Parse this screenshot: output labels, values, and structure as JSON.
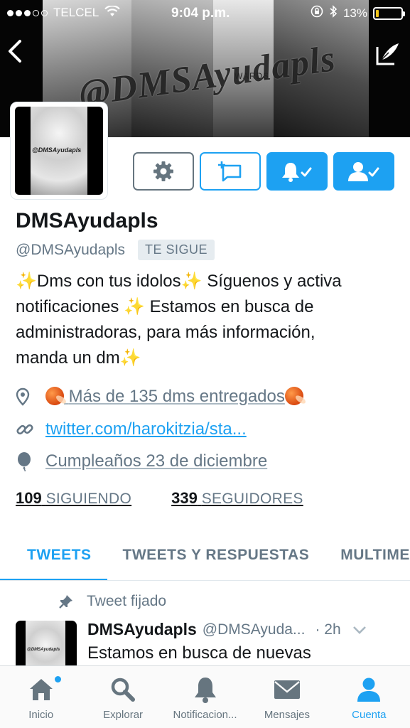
{
  "status_bar": {
    "carrier": "TELCEL",
    "time": "9:04 p.m.",
    "battery": "13%",
    "battery_level": 0.13
  },
  "banner": {
    "watermark": "@DMSAyudapls",
    "awards_text": "WARDS"
  },
  "avatar": {
    "text": "@DMSAyudapls"
  },
  "profile": {
    "name": "DMSAyudapls",
    "handle": "@DMSAyudapls",
    "follows_you": "TE SIGUE",
    "bio_lines": [
      "Dms con tus idolos",
      "Síguenos y activa",
      "notificaciones ",
      "Estamos en busca de",
      "administradoras, para más información,",
      "manda un dm"
    ],
    "sparkle": "✨",
    "location": "Más de 135 dms entregados",
    "website": "twitter.com/harokitzia/sta...",
    "birthday": "Cumpleaños 23 de diciembre",
    "following_count": "109",
    "following_label": "SIGUIENDO",
    "followers_count": "339",
    "followers_label": "SEGUIDORES"
  },
  "tabs": [
    {
      "label": "TWEETS",
      "active": true
    },
    {
      "label": "TWEETS Y RESPUESTAS",
      "active": false
    },
    {
      "label": "MULTIMEDIA",
      "active": false
    }
  ],
  "pinned_tweet": {
    "pinned_label": "Tweet fijado",
    "author": "DMSAyudapls",
    "handle": "@DMSAyuda...",
    "time": "· 2h",
    "text": "Estamos en busca de nuevas"
  },
  "tab_bar": [
    {
      "label": "Inicio",
      "icon": "home-icon",
      "active": false
    },
    {
      "label": "Explorar",
      "icon": "search-icon",
      "active": false
    },
    {
      "label": "Notificacion...",
      "icon": "bell-icon",
      "active": false
    },
    {
      "label": "Mensajes",
      "icon": "envelope-icon",
      "active": false
    },
    {
      "label": "Cuenta",
      "icon": "person-icon",
      "active": true
    }
  ],
  "colors": {
    "accent": "#1da1f2",
    "muted": "#657786",
    "text": "#14171a"
  }
}
